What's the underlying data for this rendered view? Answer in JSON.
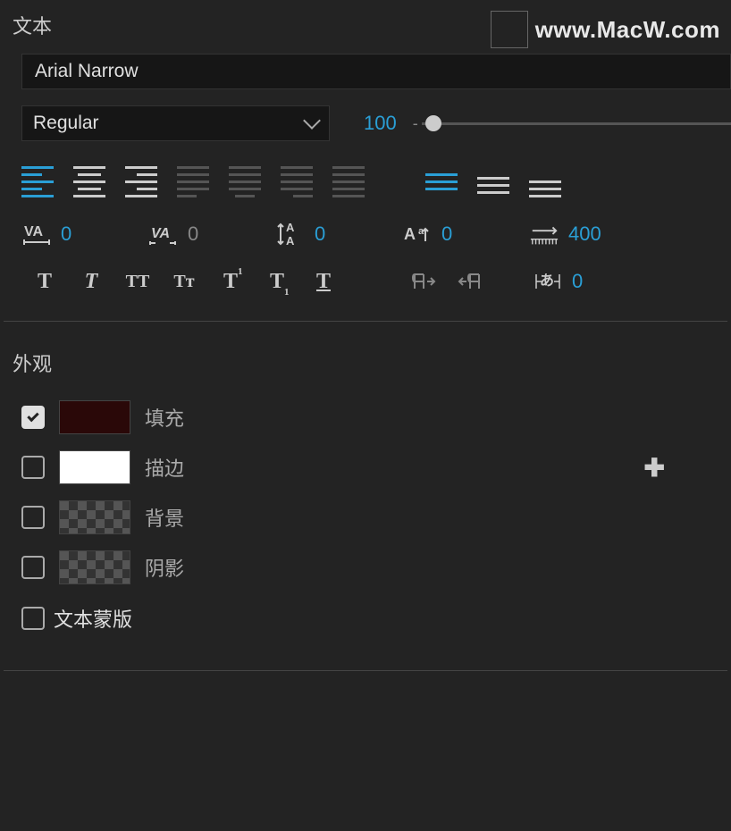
{
  "watermark": "www.MacW.com",
  "text_section_title": "文本",
  "font_family": "Arial Narrow",
  "font_style": "Regular",
  "font_size": "100",
  "tracking": "0",
  "kerning": "0",
  "leading": "0",
  "baseline_shift": "0",
  "tsume": "400",
  "tsume2": "0",
  "appearance_title": "外观",
  "fill_label": "填充",
  "stroke_label": "描边",
  "background_label": "背景",
  "shadow_label": "阴影",
  "mask_label": "文本蒙版",
  "style_bold": "T",
  "style_italic": "T",
  "style_allcaps": "TT",
  "style_smallcaps": "Tᴛ",
  "style_super": "T",
  "style_sub": "T",
  "style_underline": "T"
}
